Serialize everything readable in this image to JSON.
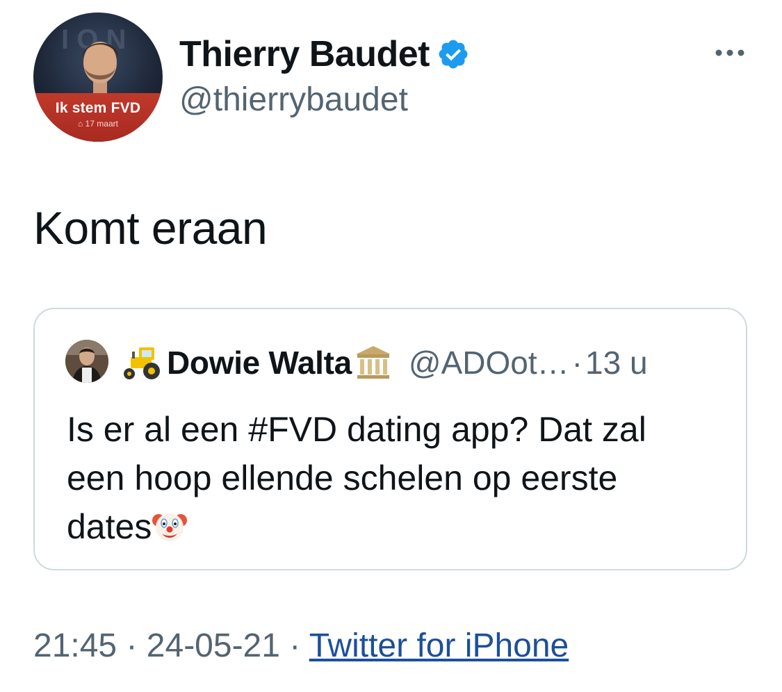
{
  "author": {
    "display_name": "Thierry Baudet",
    "handle": "@thierrybaudet",
    "verified_icon": "verified-badge-icon",
    "avatar_slogan": "Ik stem FVD",
    "avatar_date": "17 maart"
  },
  "tweet": {
    "text": "Komt eraan",
    "timestamp_time": "21:45",
    "separator": "·",
    "timestamp_date": "24-05-21",
    "source": "Twitter for iPhone"
  },
  "quoted_tweet": {
    "display_name": "Dowie Walta",
    "handle": "@ADOot…",
    "separator": "·",
    "time_ago": "13 u",
    "text_line1": "Is er al een #FVD dating app? Dat zal",
    "text_line2": "een hoop ellende schelen op eerste",
    "text_line3": "dates",
    "name_prefix_icon": "tractor-icon",
    "name_suffix_icon": "classical-building-icon",
    "text_suffix_icon": "clown-face-icon"
  },
  "colors": {
    "text_primary": "#0f1419",
    "text_secondary": "#536471",
    "verified_blue": "#1d9bf0",
    "link": "#1d4f9b",
    "border": "#cfd9de"
  }
}
